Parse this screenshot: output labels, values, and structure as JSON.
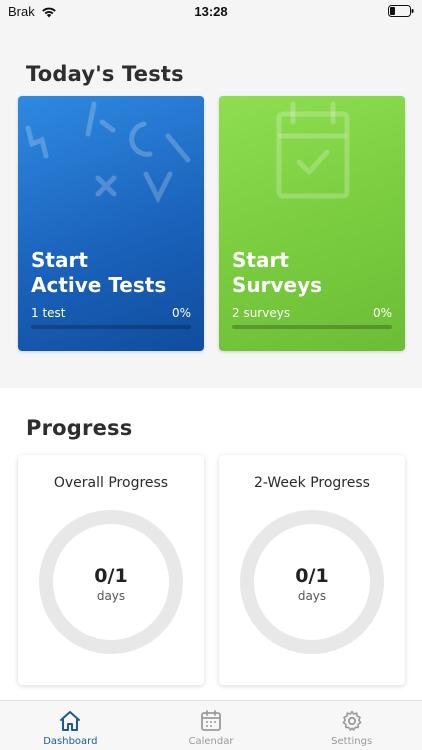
{
  "status_bar": {
    "carrier": "Brak",
    "time": "13:28",
    "wifi_icon": "wifi-icon",
    "battery_icon": "battery-icon"
  },
  "todays_tests": {
    "title": "Today's Tests",
    "tiles": [
      {
        "title": "Start\nActive Tests",
        "count": "1 test",
        "percent": "0%",
        "progress": 0,
        "color": "#1b63bd",
        "icon": "math-symbols-icon"
      },
      {
        "title": "Start\nSurveys",
        "count": "2 surveys",
        "percent": "0%",
        "progress": 0,
        "color": "#7ccf41",
        "icon": "clipboard-check-icon"
      }
    ]
  },
  "progress": {
    "title": "Progress",
    "cards": [
      {
        "title": "Overall Progress",
        "value": "0/1",
        "unit": "days",
        "fraction": 0
      },
      {
        "title": "2-Week Progress",
        "value": "0/1",
        "unit": "days",
        "fraction": 0
      }
    ]
  },
  "tabbar": {
    "tabs": [
      {
        "label": "Dashboard",
        "icon": "home-icon",
        "active": true
      },
      {
        "label": "Calendar",
        "icon": "calendar-icon",
        "active": false
      },
      {
        "label": "Settings",
        "icon": "gear-icon",
        "active": false
      }
    ],
    "active_color": "#1f5a96",
    "inactive_color": "#9a9a9a"
  }
}
